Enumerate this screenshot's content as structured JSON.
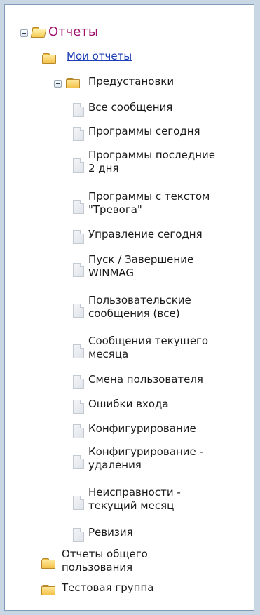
{
  "tree": {
    "root": {
      "label": "Отчеты"
    },
    "my_reports": {
      "label": "Мои отчеты"
    },
    "presets": {
      "label": "Предустановки",
      "items": [
        {
          "label": "Все сообщения"
        },
        {
          "label": "Программы сегодня"
        },
        {
          "label": "Программы последние\n2 дня"
        },
        {
          "label": "Программы с текстом\n\"Тревога\""
        },
        {
          "label": "Управление сегодня"
        },
        {
          "label": "Пуск / Завершение\nWINMAG"
        },
        {
          "label": "Пользовательские\nсообщения (все)"
        },
        {
          "label": "Сообщения текущего\nмесяца"
        },
        {
          "label": "Смена пользователя"
        },
        {
          "label": "Ошибки входа"
        },
        {
          "label": "Конфигурирование"
        },
        {
          "label": "Конфигурирование -\nудаления"
        },
        {
          "label": "Неисправности -\nтекущий месяц"
        },
        {
          "label": "Ревизия"
        }
      ]
    },
    "shared_reports": {
      "label": "Отчеты общего\nпользования"
    },
    "test_group": {
      "label": "Тестовая группа"
    }
  }
}
